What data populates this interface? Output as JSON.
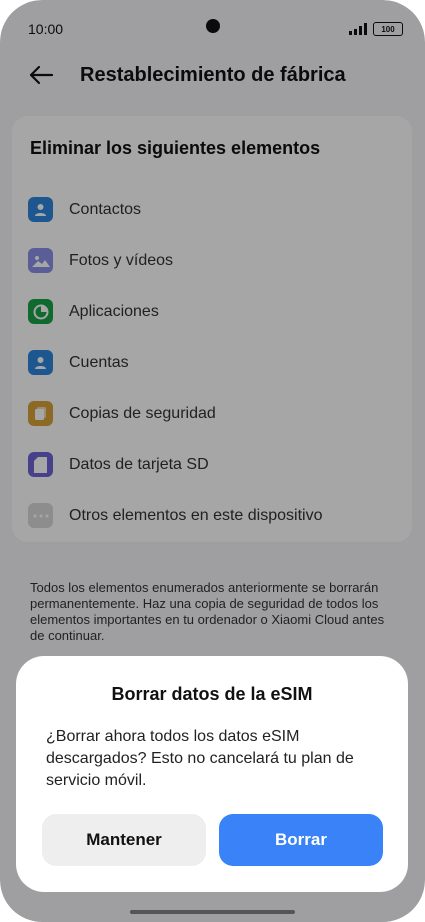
{
  "status": {
    "time": "10:00",
    "battery": "100"
  },
  "header": {
    "title": "Restablecimiento de fábrica"
  },
  "card": {
    "title": "Eliminar los siguientes elementos",
    "items": [
      {
        "label": "Contactos",
        "icon": "contacts-icon",
        "color": "#2f86de"
      },
      {
        "label": "Fotos y vídeos",
        "icon": "gallery-icon",
        "color": "#8a8fe6"
      },
      {
        "label": "Aplicaciones",
        "icon": "apps-icon",
        "color": "#1aa34a"
      },
      {
        "label": "Cuentas",
        "icon": "account-icon",
        "color": "#2f86de"
      },
      {
        "label": "Copias de seguridad",
        "icon": "backup-icon",
        "color": "#d7a43a"
      },
      {
        "label": "Datos de tarjeta SD",
        "icon": "sd-card-icon",
        "color": "#6d64d6"
      },
      {
        "label": "Otros elementos en este dispositivo",
        "icon": "more-icon",
        "color": "#d9d9d9"
      }
    ]
  },
  "description": "Todos los elementos enumerados anteriormente se borrarán permanentemente. Haz una copia de seguridad de todos los elementos importantes en tu ordenador o Xiaomi Cloud antes de continuar.",
  "dialog": {
    "title": "Borrar datos de la eSIM",
    "message": "¿Borrar ahora todos los datos eSIM descargados? Esto no cancelará tu plan de servicio móvil.",
    "keep_label": "Mantener",
    "erase_label": "Borrar"
  },
  "colors": {
    "accent": "#3a82f7",
    "overlay": "rgba(0,0,0,0.35)"
  }
}
